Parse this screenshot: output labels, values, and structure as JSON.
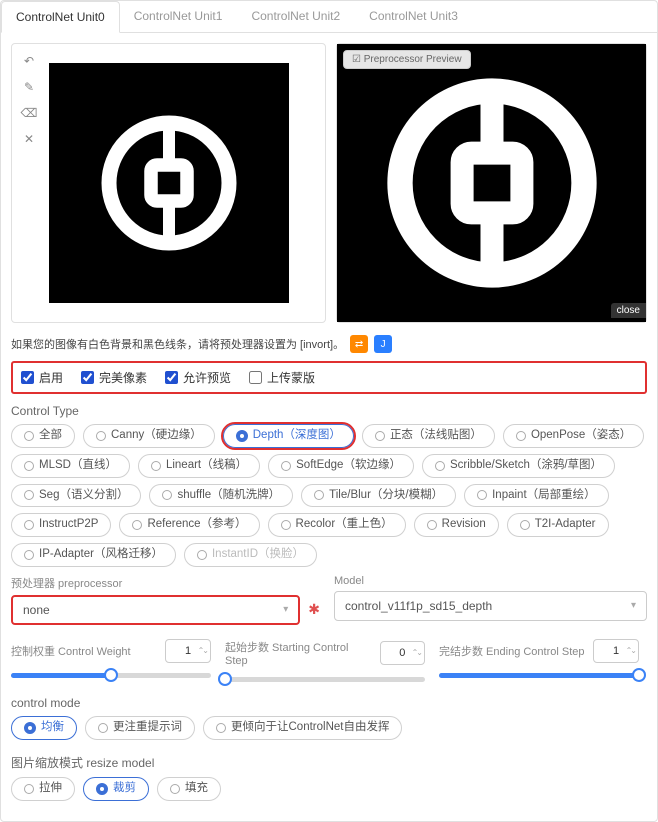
{
  "tabs": [
    "ControlNet Unit0",
    "ControlNet Unit1",
    "ControlNet Unit2",
    "ControlNet Unit3"
  ],
  "active_tab": 0,
  "preview_badge": "Preprocessor Preview",
  "close_label": "close",
  "help_text": "如果您的图像有白色背景和黑色线条，请将预处理器设置为 [invort]。",
  "checks": {
    "enable": "启用",
    "pixel_perfect": "完美像素",
    "allow_preview": "允许预览",
    "upload_mask": "上传蒙版"
  },
  "control_type_label": "Control Type",
  "control_types": [
    {
      "label": "全部",
      "sel": false
    },
    {
      "label": "Canny（硬边缘）",
      "sel": false
    },
    {
      "label": "Depth（深度图）",
      "sel": true,
      "red": true
    },
    {
      "label": "正态（法线贴图）",
      "sel": false
    },
    {
      "label": "OpenPose（姿态）",
      "sel": false
    },
    {
      "label": "MLSD（直线）",
      "sel": false
    },
    {
      "label": "Lineart（线稿）",
      "sel": false
    },
    {
      "label": "SoftEdge（软边缘）",
      "sel": false
    },
    {
      "label": "Scribble/Sketch（涂鸦/草图）",
      "sel": false
    },
    {
      "label": "Seg（语义分割）",
      "sel": false
    },
    {
      "label": "shuffle（随机洗牌）",
      "sel": false
    },
    {
      "label": "Tile/Blur（分块/模糊）",
      "sel": false
    },
    {
      "label": "Inpaint（局部重绘）",
      "sel": false
    },
    {
      "label": "InstructP2P",
      "sel": false
    },
    {
      "label": "Reference（参考）",
      "sel": false
    },
    {
      "label": "Recolor（重上色）",
      "sel": false
    },
    {
      "label": "Revision",
      "sel": false
    },
    {
      "label": "T2I-Adapter",
      "sel": false
    },
    {
      "label": "IP-Adapter（风格迁移）",
      "sel": false
    },
    {
      "label": "InstantID（换脸）",
      "sel": false,
      "disabled": true
    }
  ],
  "preproc": {
    "label": "预处理器 preprocessor",
    "value": "none"
  },
  "model": {
    "label": "Model",
    "value": "control_v11f1p_sd15_depth"
  },
  "weight": {
    "label": "控制权重 Control Weight",
    "value": "1",
    "fill": 50
  },
  "start": {
    "label": "起始步数 Starting Control Step",
    "value": "0",
    "fill": 0
  },
  "end": {
    "label": "完结步数 Ending Control Step",
    "value": "1",
    "fill": 100
  },
  "control_mode": {
    "label": "control mode",
    "options": [
      {
        "label": "均衡",
        "sel": true
      },
      {
        "label": "更注重提示词",
        "sel": false
      },
      {
        "label": "更倾向于让ControlNet自由发挥",
        "sel": false
      }
    ]
  },
  "resize_mode": {
    "label": "图片缩放模式 resize model",
    "options": [
      {
        "label": "拉伸",
        "sel": false
      },
      {
        "label": "裁剪",
        "sel": true
      },
      {
        "label": "填充",
        "sel": false
      }
    ]
  }
}
